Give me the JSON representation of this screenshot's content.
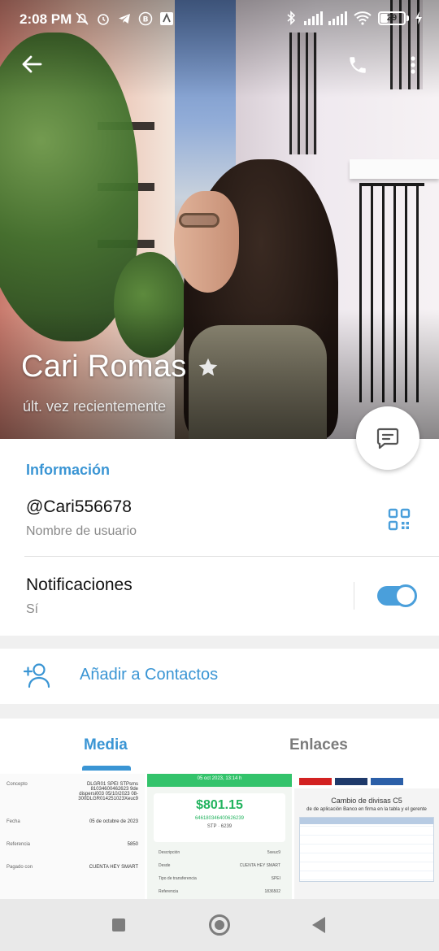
{
  "status_bar": {
    "time": "2:08 PM",
    "battery": "29"
  },
  "profile": {
    "name": "Cari Romas",
    "last_seen": "últ. vez recientemente"
  },
  "info": {
    "section_title": "Información",
    "username": "@Cari556678",
    "username_label": "Nombre de usuario",
    "notifications_label": "Notificaciones",
    "notifications_value": "Sí",
    "notifications_enabled": true
  },
  "actions": {
    "add_contact": "Añadir a Contactos"
  },
  "tabs": [
    {
      "label": "Media",
      "active": true
    },
    {
      "label": "Enlaces",
      "active": false
    }
  ],
  "media": {
    "receipt": {
      "rows": [
        {
          "key": "Concepto",
          "value": "DLGR01 SPEI STPsms 81034600462623 9de dispersi003 05/10/2023 08-300DLGR014251023Xeuc9"
        },
        {
          "key": "Fecha",
          "value": "05 de octubre de 2023"
        },
        {
          "key": "Referencia",
          "value": "5850"
        },
        {
          "key": "Pagado con",
          "value": "CUENTA HEY SMART"
        }
      ]
    },
    "transfer": {
      "header": "05 oct 2023, 13:14 h",
      "amount": "$801.15",
      "account": "646180346400626239",
      "bank": "STP · 6239",
      "lines": [
        {
          "key": "Descripción",
          "value": "5xeuc9"
        },
        {
          "key": "Desde",
          "value": "CUENTA HEY SMART"
        },
        {
          "key": "Tipo de transferencia",
          "value": "SPEI"
        },
        {
          "key": "Referencia",
          "value": "1836502"
        }
      ]
    },
    "exchange": {
      "title": "Cambio de divisas C5",
      "subtitle": "de de aplicación Banco en firma en la tabla y el gerente"
    }
  },
  "colors": {
    "accent": "#3a95d4",
    "toggle": "#4a9fdb",
    "receipt_green": "#33c36b"
  }
}
